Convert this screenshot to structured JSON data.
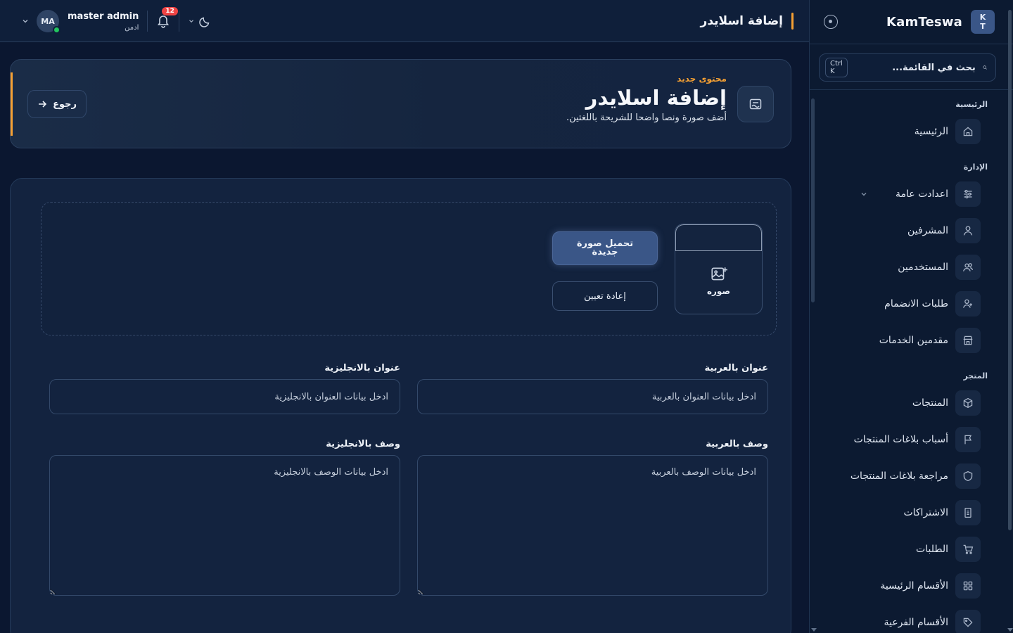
{
  "brand": {
    "logo_line1": "K",
    "logo_line2": "T",
    "name": "KamTeswa"
  },
  "sidebar": {
    "search_placeholder": "بحث في القائمة...",
    "search_shortcut": "Ctrl K",
    "sections": [
      {
        "title": "الرئيسية",
        "items": [
          {
            "label": "الرئيسية",
            "icon": "home-icon"
          }
        ]
      },
      {
        "title": "الإدارة",
        "items": [
          {
            "label": "اعدادت عامة",
            "icon": "sliders-icon",
            "has_submenu": true
          },
          {
            "label": "المشرفين",
            "icon": "user-icon"
          },
          {
            "label": "المستخدمين",
            "icon": "users-icon"
          },
          {
            "label": "طلبات الانضمام",
            "icon": "user-plus-icon"
          },
          {
            "label": "مقدمين الخدمات",
            "icon": "store-icon"
          }
        ]
      },
      {
        "title": "المتجر",
        "items": [
          {
            "label": "المنتجات",
            "icon": "box-icon"
          },
          {
            "label": "أسباب بلاغات المنتجات",
            "icon": "flag-icon"
          },
          {
            "label": "مراجعة بلاغات المنتجات",
            "icon": "shield-icon"
          },
          {
            "label": "الاشتراكات",
            "icon": "receipt-icon"
          },
          {
            "label": "الطلبات",
            "icon": "cart-icon"
          },
          {
            "label": "الأقسام الرئيسية",
            "icon": "grid-icon"
          },
          {
            "label": "الأقسام الفرعية",
            "icon": "tag-icon"
          }
        ]
      }
    ]
  },
  "topbar": {
    "title": "إضافة اسلايدر",
    "notification_count": "12",
    "user": {
      "initials": "MA",
      "name": "master admin",
      "role": "ادمن"
    }
  },
  "hero": {
    "kicker": "محتوى جديد",
    "title": "إضافة اسلايدر",
    "subtitle": "أضف صورة ونصا واضحا للشريحة باللغتين.",
    "back_label": "رجوع"
  },
  "form": {
    "image_label": "صوره",
    "upload_label": "تحميل صورة جديدة",
    "reset_label": "إعادة تعيين",
    "title_ar": {
      "label": "عنوان بالعربية",
      "placeholder": "ادخل بيانات العنوان بالعربية",
      "value": ""
    },
    "title_en": {
      "label": "عنوان بالانجليزية",
      "placeholder": "ادخل بيانات العنوان بالانجليزية",
      "value": ""
    },
    "desc_ar": {
      "label": "وصف بالعربية",
      "placeholder": "ادخل بيانات الوصف بالعربية",
      "value": ""
    },
    "desc_en": {
      "label": "وصف بالانجليزية",
      "placeholder": "ادخل بيانات الوصف بالانجليزية",
      "value": ""
    }
  },
  "colors": {
    "accent": "#f5a033",
    "primary": "#3a5687",
    "online": "#22c55e",
    "badge": "#ef4444"
  }
}
